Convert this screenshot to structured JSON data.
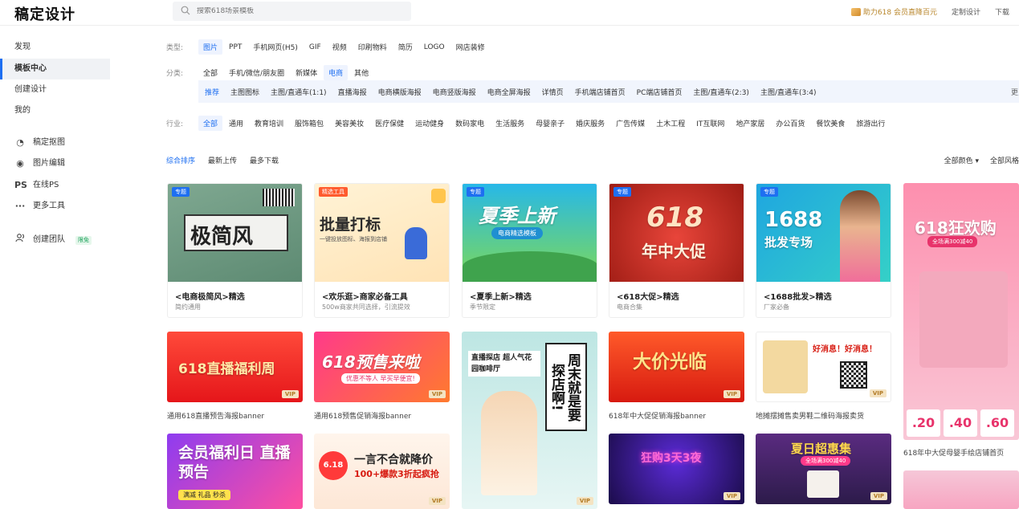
{
  "header": {
    "logo": "稿定设计",
    "search_placeholder": "搜索618场景模板",
    "vip_link": "助力618 会员直降百元",
    "custom_design": "定制设计",
    "download": "下载"
  },
  "sidebar": {
    "items": [
      "发现",
      "模板中心",
      "创建设计",
      "我的"
    ],
    "tools": [
      {
        "icon": "matting-icon",
        "glyph": "◔",
        "label": "稿定抠图"
      },
      {
        "icon": "image-edit-icon",
        "glyph": "◉",
        "label": "图片编辑"
      },
      {
        "icon": "ps-icon",
        "glyph": "PS",
        "label": "在线PS"
      },
      {
        "icon": "more-icon",
        "glyph": "···",
        "label": "更多工具"
      }
    ],
    "team": {
      "label": "创建团队",
      "tag": "限免"
    }
  },
  "filters": {
    "type_label": "类型:",
    "types": [
      "图片",
      "PPT",
      "手机网页(H5)",
      "GIF",
      "视频",
      "印刷物料",
      "简历",
      "LOGO",
      "网店装修"
    ],
    "category_label": "分类:",
    "categories": [
      "全部",
      "手机/微信/朋友圈",
      "新媒体",
      "电商",
      "其他"
    ],
    "subcategories": [
      "推荐",
      "主图图标",
      "主图/直通车(1:1)",
      "直播海报",
      "电商横版海报",
      "电商竖版海报",
      "电商全屏海报",
      "详情页",
      "手机端店铺首页",
      "PC端店铺首页",
      "主图/直通车(2:3)",
      "主图/直通车(3:4)"
    ],
    "more": "更多",
    "industry_label": "行业:",
    "industries": [
      "全部",
      "通用",
      "教育培训",
      "服饰箱包",
      "美容美妆",
      "医疗保健",
      "运动健身",
      "数码家电",
      "生活服务",
      "母婴亲子",
      "婚庆服务",
      "广告传媒",
      "土木工程",
      "IT互联网",
      "地产家居",
      "办公百货",
      "餐饮美食",
      "旅游出行"
    ]
  },
  "sort": {
    "options": [
      "综合排序",
      "最新上传",
      "最多下载"
    ],
    "color": "全部颜色",
    "style": "全部风格"
  },
  "featured": [
    {
      "badge": "专题",
      "big": "极简风",
      "title": "<电商极简风>精选",
      "sub": "简约通用"
    },
    {
      "badge": "精选工具",
      "big": "批量打标",
      "tagline": "一键投放图标、海报到店铺",
      "title": "<欢乐逛>商家必备工具",
      "sub": "500w商家共同选择，引流提效"
    },
    {
      "badge": "专题",
      "big": "夏季上新",
      "tagline": "电商精选模板",
      "title": "<夏季上新>精选",
      "sub": "季节限定"
    },
    {
      "badge": "专题",
      "big": "618",
      "tagline": "年中大促",
      "title": "<618大促>精选",
      "sub": "电商合集"
    },
    {
      "badge": "专题",
      "big": "1688",
      "tagline": "批发专场",
      "title": "<1688批发>精选",
      "sub": "厂家必备"
    }
  ],
  "templates": [
    {
      "big": "618直播福利周",
      "vip": "VIP",
      "caption": "通用618直播预告海报banner"
    },
    {
      "big": "618预售来啦",
      "tagline": "优惠不等人 早买早便宜!",
      "vip": "VIP",
      "caption": "通用618预售促销海报banner"
    },
    {
      "big": "周末就是要探店啊!",
      "tagline": "直播探店 超人气花园咖啡厅",
      "vip": "VIP"
    },
    {
      "big": "大价光临",
      "vip": "VIP",
      "caption": "618年中大促促销海报banner"
    },
    {
      "big": "好消息！好消息！",
      "vip": "VIP",
      "caption": "地摊摆摊售卖男鞋二维码海报卖货"
    },
    {
      "big": "618狂欢购",
      "tagline": "全场满300减40",
      "caption": "618年中大促母婴手绘店铺首页"
    },
    {
      "big": "会员福利日 直播预告",
      "tagline": "满减 礼品 秒杀"
    },
    {
      "big": "一言不合就降价",
      "tagline": "100+爆款3折起疯抢",
      "vip": "VIP"
    },
    {
      "big": "狂购3天3夜",
      "vip": "VIP"
    },
    {
      "big": "夏日超惠集",
      "tagline": "全场满300减40",
      "vip": "VIP"
    }
  ]
}
